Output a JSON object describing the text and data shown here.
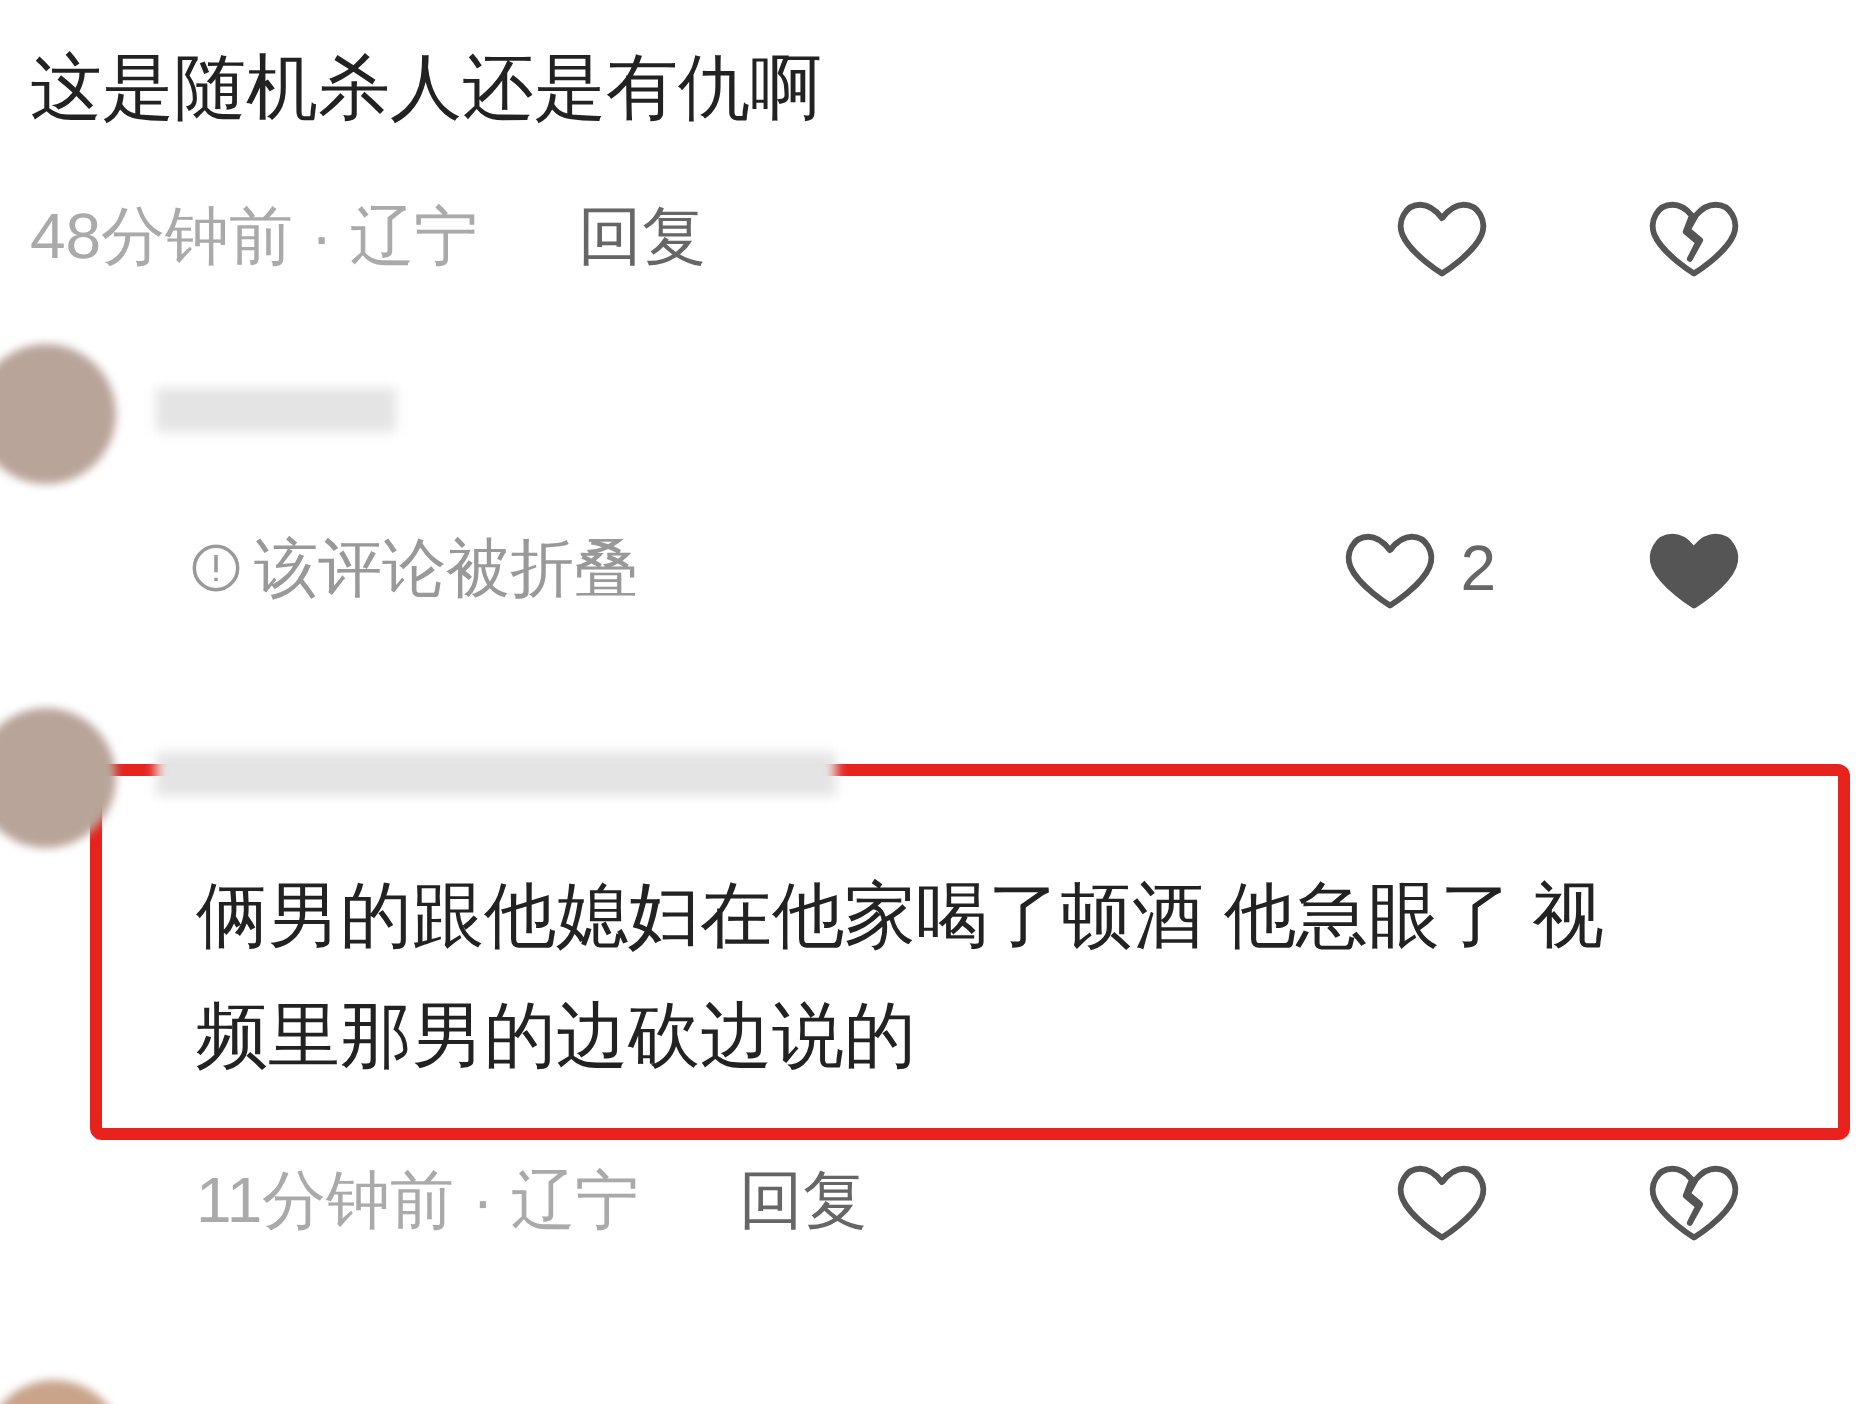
{
  "comments": [
    {
      "kind": "normal",
      "text": "这是随机杀人还是有仇啊",
      "meta": "48分钟前 · 辽宁",
      "reply": "回复",
      "liked": false,
      "disliked": false,
      "highlighted": false,
      "avatar": false
    },
    {
      "kind": "folded",
      "notice": "该评论被折叠",
      "likes": "2",
      "liked": false,
      "disliked": true,
      "avatar": true
    },
    {
      "kind": "normal",
      "text": "俩男的跟他媳妇在他家喝了顿酒 他急眼了 视频里那男的边砍边说的",
      "meta": "11分钟前 · 辽宁",
      "reply": "回复",
      "liked": false,
      "disliked": false,
      "highlighted": true,
      "avatar": true
    }
  ]
}
